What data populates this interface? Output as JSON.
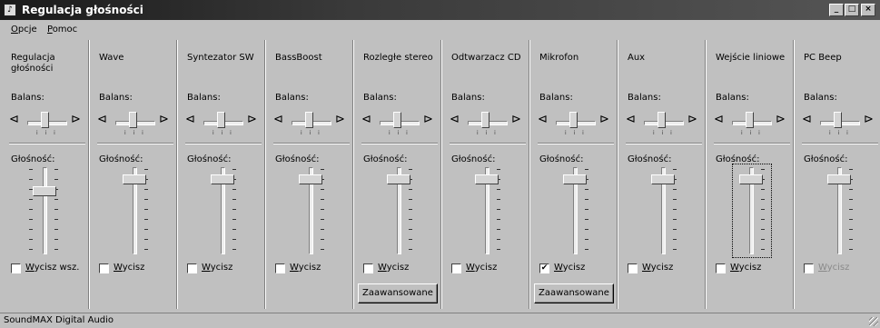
{
  "window": {
    "title": "Regulacja głośności",
    "icon": "speaker-icon",
    "min": "_",
    "max": "□",
    "close": "×"
  },
  "menu": [
    {
      "u": "O",
      "rest": "pcje"
    },
    {
      "u": "P",
      "rest": "omoc"
    }
  ],
  "labels": {
    "balance": "Balans:",
    "volume": "Głośność:"
  },
  "channels": [
    {
      "name": "Regulacja głośności",
      "mute_u": "W",
      "mute_rest": "ycisz wsz.",
      "muted": false,
      "disabled": false,
      "master": true
    },
    {
      "name": "Wave",
      "mute_u": "W",
      "mute_rest": "ycisz",
      "muted": false,
      "disabled": false
    },
    {
      "name": "Syntezator SW",
      "mute_u": "W",
      "mute_rest": "ycisz",
      "muted": false,
      "disabled": false
    },
    {
      "name": "BassBoost",
      "mute_u": "W",
      "mute_rest": "ycisz",
      "muted": false,
      "disabled": false
    },
    {
      "name": "Rozległe stereo",
      "mute_u": "W",
      "mute_rest": "ycisz",
      "muted": false,
      "disabled": false,
      "advanced": "Zaawansowane"
    },
    {
      "name": "Odtwarzacz CD",
      "mute_u": "W",
      "mute_rest": "ycisz",
      "muted": false,
      "disabled": false
    },
    {
      "name": "Mikrofon",
      "mute_u": "W",
      "mute_rest": "ycisz",
      "muted": true,
      "disabled": false,
      "advanced": "Zaawansowane"
    },
    {
      "name": "Aux",
      "mute_u": "W",
      "mute_rest": "ycisz",
      "muted": false,
      "disabled": false
    },
    {
      "name": "Wejście liniowe",
      "mute_u": "W",
      "mute_rest": "ycisz",
      "muted": false,
      "disabled": false,
      "focused": true
    },
    {
      "name": "PC Beep",
      "mute_u": "W",
      "mute_rest": "ycisz",
      "muted": false,
      "disabled": true
    }
  ],
  "volume_levels": [
    0.75,
    0.9,
    0.9,
    0.9,
    0.9,
    0.9,
    0.9,
    0.9,
    0.9,
    0.9
  ],
  "status": "SoundMAX Digital Audio",
  "colors": {
    "face": "#c0c0c0",
    "titlebar": "#2a2a2a"
  }
}
